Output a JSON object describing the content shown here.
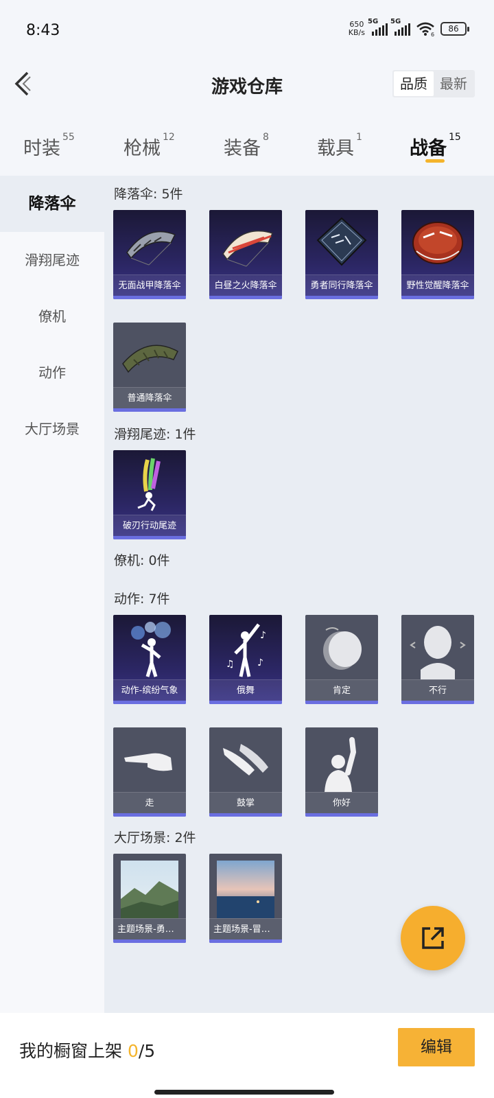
{
  "status": {
    "time": "8:43",
    "speed_value": "650",
    "speed_unit": "KB/s",
    "net1": "5G",
    "net2": "5G",
    "wifi_sub": "6",
    "battery": "86"
  },
  "header": {
    "title": "游戏仓库",
    "sort_quality": "品质",
    "sort_latest": "最新"
  },
  "tabs": [
    {
      "label": "时装",
      "count": "55"
    },
    {
      "label": "枪械",
      "count": "12"
    },
    {
      "label": "装备",
      "count": "8"
    },
    {
      "label": "载具",
      "count": "1"
    },
    {
      "label": "战备",
      "count": "15"
    }
  ],
  "sidebar": {
    "items": [
      "降落伞",
      "滑翔尾迹",
      "僚机",
      "动作",
      "大厅场景"
    ]
  },
  "sections": {
    "parachute": {
      "title": "降落伞: 5件",
      "items": [
        "无面战甲降落伞",
        "白昼之火降落伞",
        "勇者同行降落伞",
        "野性觉醒降落伞",
        "普通降落伞"
      ]
    },
    "trail": {
      "title": "滑翔尾迹: 1件",
      "items": [
        "破刃行动尾迹"
      ]
    },
    "wingman": {
      "title": "僚机: 0件"
    },
    "emote": {
      "title": "动作: 7件",
      "items": [
        "动作-缤纷气象",
        "俄舞",
        "肯定",
        "不行",
        "走",
        "鼓掌",
        "你好"
      ]
    },
    "lobby": {
      "title": "大厅场景: 2件",
      "items": [
        "主题场景-勇者同行",
        "主题场景-冒险之旅"
      ]
    }
  },
  "bottom": {
    "shelf_label": "我的橱窗上架",
    "shelf_count": "0",
    "shelf_total": "/5",
    "edit_label": "编辑"
  },
  "colors": {
    "accent": "#f4b42c",
    "rarity_bar": "#6a6ee0",
    "purple_card": "#2b2663",
    "gray_card": "#4e5262"
  }
}
